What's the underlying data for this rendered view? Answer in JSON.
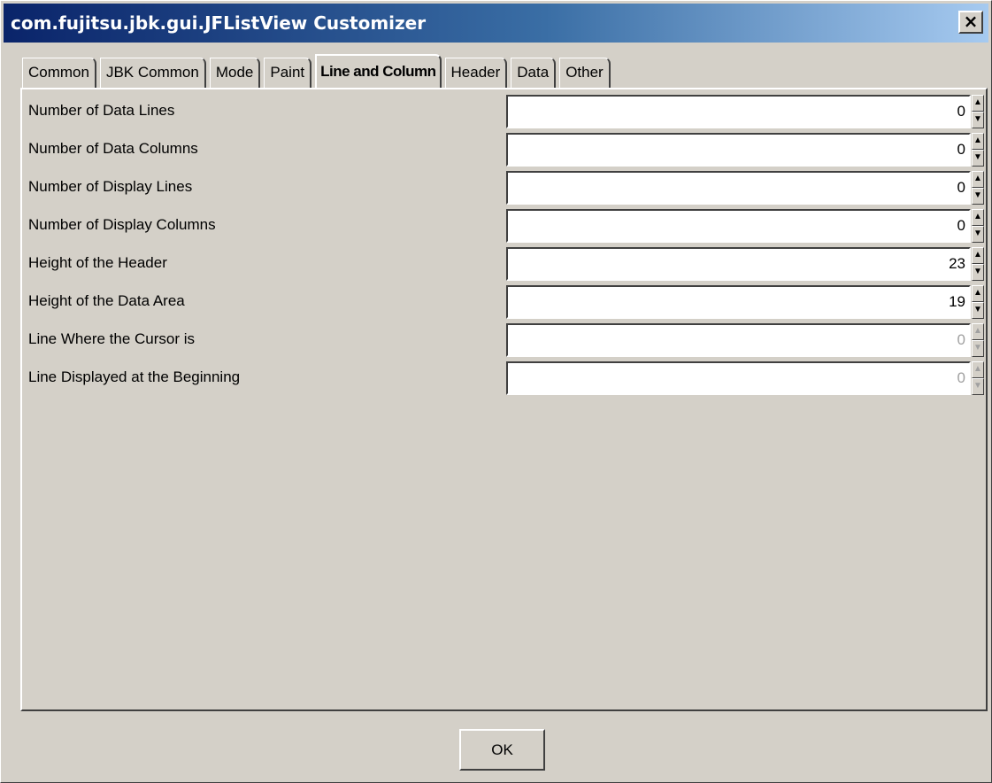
{
  "window": {
    "title": "com.fujitsu.jbk.gui.JFListView Customizer",
    "close_glyph": "×"
  },
  "tabs": [
    {
      "label": "Common",
      "active": false
    },
    {
      "label": "JBK Common",
      "active": false
    },
    {
      "label": "Mode",
      "active": false
    },
    {
      "label": "Paint",
      "active": false
    },
    {
      "label": "Line and Column",
      "active": true
    },
    {
      "label": "Header",
      "active": false
    },
    {
      "label": "Data",
      "active": false
    },
    {
      "label": "Other",
      "active": false
    }
  ],
  "fields": [
    {
      "label": "Number of Data Lines",
      "value": "0",
      "enabled": true
    },
    {
      "label": "Number of Data Columns",
      "value": "0",
      "enabled": true
    },
    {
      "label": "Number of Display Lines",
      "value": "0",
      "enabled": true
    },
    {
      "label": "Number of Display Columns",
      "value": "0",
      "enabled": true
    },
    {
      "label": "Height of the Header",
      "value": "23",
      "enabled": true
    },
    {
      "label": "Height of the Data Area",
      "value": "19",
      "enabled": true
    },
    {
      "label": "Line Where the Cursor is",
      "value": "0",
      "enabled": false
    },
    {
      "label": "Line Displayed at the Beginning",
      "value": "0",
      "enabled": false
    }
  ],
  "icons": {
    "spin_up": "▲",
    "spin_down": "▼"
  },
  "buttons": {
    "ok_label": "OK"
  },
  "colors": {
    "title_bar": "#0a246a",
    "face": "#d4d0c8",
    "disabled_text": "#a0a0a0"
  }
}
